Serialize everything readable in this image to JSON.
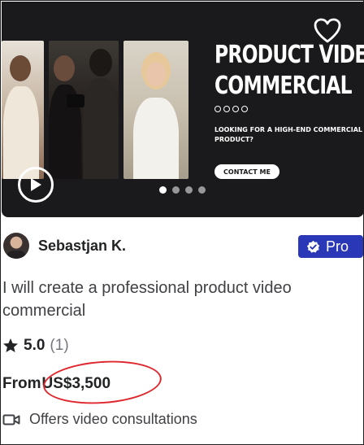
{
  "banner": {
    "title_line1": "PRODUCT VIDE",
    "title_line2": "COMMERCIAL",
    "tagline": "LOOKING FOR A HIGH-END COMMERCIAL FOR YOUR\nPRODUCT?",
    "contact_label": "CONTACT ME",
    "carousel": {
      "total": 4,
      "active_index": 0
    }
  },
  "seller": {
    "name": "Sebastjan K.",
    "badge_label": "Pro"
  },
  "gig": {
    "title": "I will create a professional product video commercial",
    "rating": "5.0",
    "review_count": "(1)",
    "price_prefix": "From",
    "price_amount": "US$3,500",
    "consultation_label": "Offers video consultations"
  },
  "colors": {
    "pro_badge": "#2a38b8",
    "annotation_circle": "#e0262d",
    "banner_bg": "#1a1a1c"
  },
  "icons": [
    "heart-icon",
    "play-icon",
    "star-icon",
    "pro-check-icon",
    "video-camera-icon"
  ]
}
